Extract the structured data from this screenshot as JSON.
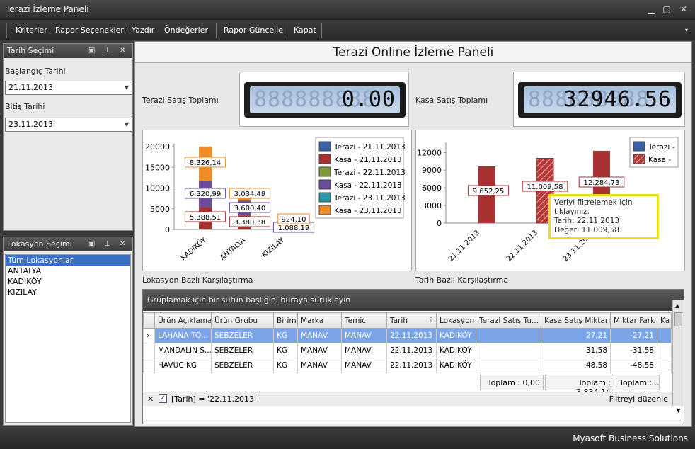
{
  "window": {
    "title": "Terazi İzleme Paneli"
  },
  "menu": {
    "items": [
      "Kriterler",
      "Rapor Seçenekleri",
      "Yazdır",
      "Öndeğerler",
      "Rapor Güncelle",
      "Kapat"
    ]
  },
  "date_panel": {
    "title": "Tarih Seçimi",
    "start_label": "Başlangıç Tarihi",
    "start_value": "21.11.2013",
    "end_label": "Bitiş Tarihi",
    "end_value": "23.11.2013"
  },
  "location_panel": {
    "title": "Lokasyon Seçimi",
    "items": [
      "Tüm Lokasyonlar",
      "ANTALYA",
      "KADIKÖY",
      "KIZILAY"
    ],
    "selected": 0
  },
  "main": {
    "title": "Terazi Online İzleme Paneli",
    "scale_total_label": "Terazi Satış Toplamı",
    "scale_total_value": "0.00",
    "cash_total_label": "Kasa Satış Toplamı",
    "cash_total_value": "32946.56",
    "location_chart_label": "Lokasyon Bazlı Karşılaştırma",
    "date_chart_label": "Tarih Bazlı Karşılaştırma"
  },
  "colors": {
    "kasa": "#a83232",
    "purple": "#6b4d9a",
    "orange": "#f08c26",
    "tooltip_border": "#e8e010"
  },
  "chart_data": [
    {
      "type": "bar",
      "categories": [
        "KADIKÖY",
        "ANTALYA",
        "KIZILAY"
      ],
      "ylim": [
        0,
        20000
      ],
      "yticks": [
        "0",
        "5000",
        "10000",
        "15000",
        "20000"
      ],
      "series": [
        {
          "name": "Terazi - 21.11.2013",
          "color": "#3a62a8",
          "values": [
            0,
            0,
            0
          ]
        },
        {
          "name": "Kasa - 21.11.2013",
          "color": "#a83232",
          "values": [
            5388.51,
            3380.38,
            0
          ]
        },
        {
          "name": "Terazi - 22.11.2013",
          "color": "#7a9a3a",
          "values": [
            0,
            0,
            0
          ]
        },
        {
          "name": "Kasa - 22.11.2013",
          "color": "#6b4d9a",
          "values": [
            6320.99,
            3600.4,
            1088.19
          ]
        },
        {
          "name": "Terazi - 23.11.2013",
          "color": "#2a9aa8",
          "values": [
            0,
            0,
            0
          ]
        },
        {
          "name": "Kasa - 23.11.2013",
          "color": "#f08c26",
          "values": [
            8326.14,
            3034.49,
            924.1
          ]
        }
      ],
      "data_labels": [
        [
          "5.388,51",
          "6.320,99",
          "8.326,14"
        ],
        [
          "3.380,38",
          "3.600,40",
          "3.034,49"
        ],
        [
          "",
          "1.088,19",
          "924,10"
        ]
      ]
    },
    {
      "type": "bar",
      "categories": [
        "21.11.2013",
        "22.11.2013",
        "23.11.2013"
      ],
      "ylim": [
        0,
        13000
      ],
      "yticks": [
        "0",
        "3000",
        "6000",
        "9000",
        "12000"
      ],
      "series": [
        {
          "name": "Terazi -",
          "color": "#3a62a8",
          "values": [
            0,
            0,
            0
          ]
        },
        {
          "name": "Kasa -",
          "color": "#a83232",
          "values": [
            9652.25,
            11009.58,
            12284.73
          ]
        }
      ],
      "data_labels": [
        "9.652,25",
        "11.009,58",
        "12.284,73"
      ],
      "highlighted_index": 1,
      "tooltip": {
        "line1": "Veriyi filtrelemek için tıklayınız.",
        "line2": "Tarih: 22.11.2013",
        "line3": "Değer: 11.009,58"
      }
    }
  ],
  "grid": {
    "group_hint": "Gruplamak için bir sütun başlığını buraya sürükleyin",
    "columns": [
      "Ürün Açıklama",
      "Ürün Grubu",
      "Birim",
      "Marka",
      "Temici",
      "Tarih",
      "Lokasyon",
      "Terazi Satış Tu...",
      "Kasa Satış Miktarı",
      "Miktar Fark",
      "Ka"
    ],
    "rows": [
      [
        "LAHANA TO...",
        "SEBZELER",
        "KG",
        "MANAV",
        "MANAV",
        "22.11.2013",
        "KADIKÖY",
        "",
        "27,21",
        "-27,21",
        ""
      ],
      [
        "MANDALIN S...",
        "SEBZELER",
        "KG",
        "MANAV",
        "MANAV",
        "22.11.2013",
        "KADIKÖY",
        "",
        "31,58",
        "-31,58",
        ""
      ],
      [
        "HAVUC KG",
        "SEBZELER",
        "KG",
        "MANAV",
        "MANAV",
        "22.11.2013",
        "KADIKÖY",
        "",
        "48,58",
        "-48,58",
        ""
      ]
    ],
    "totals": [
      "Toplam : 0,00",
      "Toplam : 3.834,14",
      "Toplam : ..."
    ],
    "filter_text": "[Tarih] = '22.11.2013'",
    "filter_edit": "Filtreyi düzenle"
  },
  "status": {
    "text": "Myasoft Business Solutions"
  }
}
